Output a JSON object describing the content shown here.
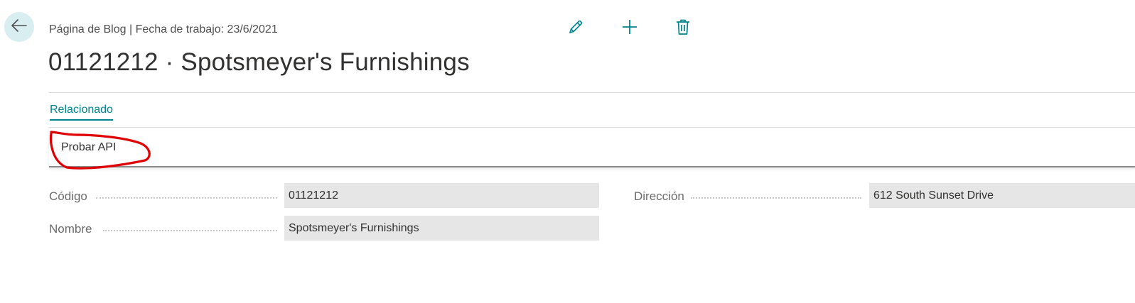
{
  "header": {
    "breadcrumb": "Página de Blog | Fecha de trabajo: 23/6/2021",
    "title": "01121212 · Spotsmeyer's Furnishings",
    "back_icon": "arrow-left-icon",
    "toolbar": [
      {
        "name": "edit",
        "icon": "pencil-icon"
      },
      {
        "name": "new",
        "icon": "plus-icon"
      },
      {
        "name": "delete",
        "icon": "trash-icon"
      }
    ]
  },
  "tabs": {
    "related": "Relacionado"
  },
  "actions": {
    "probar_api": "Probar API"
  },
  "fields": {
    "codigo": {
      "label": "Código",
      "value": "01121212"
    },
    "nombre": {
      "label": "Nombre",
      "value": "Spotsmeyer's Furnishings"
    },
    "direccion": {
      "label": "Dirección",
      "value": "612 South Sunset Drive"
    }
  },
  "colors": {
    "accent": "#00838f",
    "back_button_bg": "#d8eef1",
    "field_bg": "#e6e6e6",
    "annotation": "#e00000"
  }
}
